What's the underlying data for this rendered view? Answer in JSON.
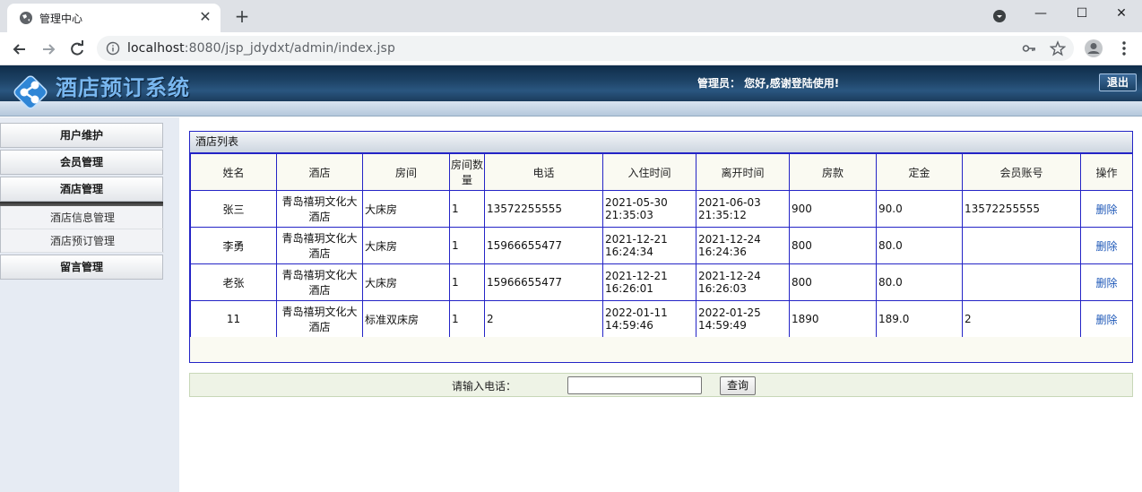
{
  "browser": {
    "tab_title": "管理中心",
    "url_host": "localhost",
    "url_rest": ":8080/jsp_jdydxt/admin/index.jsp"
  },
  "header": {
    "system_title": "酒店预订系统",
    "greeting": "管理员：  您好,感谢登陆使用!",
    "logout_label": "退出"
  },
  "sidebar": {
    "menus": [
      {
        "label": "用户维护"
      },
      {
        "label": "会员管理"
      },
      {
        "label": "酒店管理"
      },
      {
        "label": "留言管理"
      }
    ],
    "submenu": [
      {
        "label": "酒店信息管理"
      },
      {
        "label": "酒店预订管理"
      }
    ]
  },
  "panel": {
    "title": "酒店列表",
    "columns": [
      "姓名",
      "酒店",
      "房间",
      "房间数量",
      "电话",
      "入住时间",
      "离开时间",
      "房款",
      "定金",
      "会员账号",
      "操作"
    ],
    "rows": [
      {
        "name": "张三",
        "hotel": "青岛禧玥文化大酒店",
        "room": "大床房",
        "count": "1",
        "phone": "13572255555",
        "checkin_date": "2021-05-30",
        "checkin_time": "21:35:03",
        "checkout_date": "2021-06-03",
        "checkout_time": "21:35:12",
        "price": "900",
        "deposit": "90.0",
        "member": "13572255555",
        "action": "删除"
      },
      {
        "name": "李勇",
        "hotel": "青岛禧玥文化大酒店",
        "room": "大床房",
        "count": "1",
        "phone": "15966655477",
        "checkin_date": "2021-12-21",
        "checkin_time": "16:24:34",
        "checkout_date": "2021-12-24",
        "checkout_time": "16:24:36",
        "price": "800",
        "deposit": "80.0",
        "member": "",
        "action": "删除"
      },
      {
        "name": "老张",
        "hotel": "青岛禧玥文化大酒店",
        "room": "大床房",
        "count": "1",
        "phone": "15966655477",
        "checkin_date": "2021-12-21",
        "checkin_time": "16:26:01",
        "checkout_date": "2021-12-24",
        "checkout_time": "16:26:03",
        "price": "800",
        "deposit": "80.0",
        "member": "",
        "action": "删除"
      },
      {
        "name": "11",
        "hotel": "青岛禧玥文化大酒店",
        "room": "标准双床房",
        "count": "1",
        "phone": "2",
        "checkin_date": "2022-01-11",
        "checkin_time": "14:59:46",
        "checkout_date": "2022-01-25",
        "checkout_time": "14:59:49",
        "price": "1890",
        "deposit": "189.0",
        "member": "2",
        "action": "删除"
      }
    ]
  },
  "search": {
    "label": "请输入电话：",
    "value": "",
    "button_label": "查询"
  },
  "colors": {
    "banner": "#1c4164",
    "table_border": "#2424c6",
    "link": "#1e58b8"
  }
}
